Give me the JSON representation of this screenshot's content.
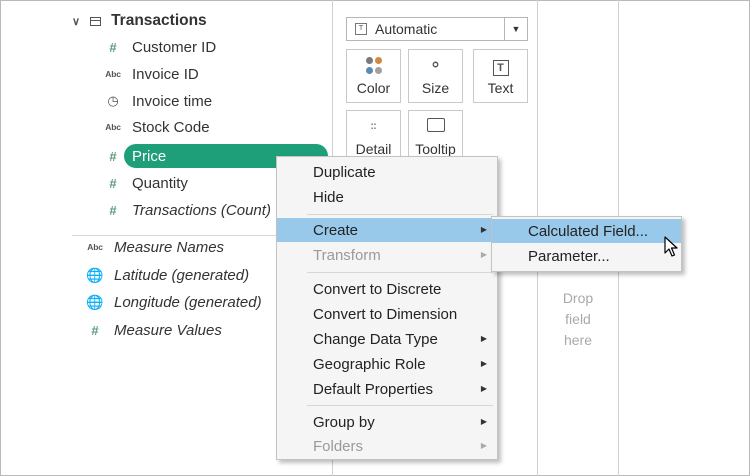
{
  "data_pane": {
    "table_name": "Transactions",
    "fields": [
      {
        "icon": "#",
        "label": "Customer ID"
      },
      {
        "icon": "Abc",
        "label": "Invoice ID"
      },
      {
        "icon": "clock",
        "label": "Invoice time"
      },
      {
        "icon": "Abc",
        "label": "Stock Code"
      },
      {
        "icon": "#",
        "label": "Price"
      },
      {
        "icon": "#",
        "label": "Quantity"
      },
      {
        "icon": "#",
        "label": "Transactions (Count)"
      }
    ],
    "extra_fields": [
      {
        "icon": "Abc",
        "label": "Measure Names"
      },
      {
        "icon": "globe",
        "label": "Latitude (generated)"
      },
      {
        "icon": "globe",
        "label": "Longitude (generated)"
      },
      {
        "icon": "#",
        "label": "Measure Values"
      }
    ]
  },
  "marks": {
    "mark_type": "Automatic",
    "buttons": [
      "Color",
      "Size",
      "Text",
      "Detail",
      "Tooltip"
    ]
  },
  "drop_zone": {
    "line1": "Drop",
    "line2": "field",
    "line3": "here"
  },
  "context_menu": {
    "items": [
      "Duplicate",
      "Hide",
      "Create",
      "Transform",
      "Convert to Discrete",
      "Convert to Dimension",
      "Change Data Type",
      "Geographic Role",
      "Default Properties",
      "Group by",
      "Folders"
    ],
    "highlighted": "Create"
  },
  "submenu": {
    "items": [
      "Calculated Field...",
      "Parameter..."
    ],
    "highlighted": "Calculated Field..."
  },
  "colors": {
    "pill": "#1e9e79",
    "highlight": "#99c9ea",
    "menu_bg": "#f5f5f5",
    "field_icon": "#4c8c72"
  }
}
